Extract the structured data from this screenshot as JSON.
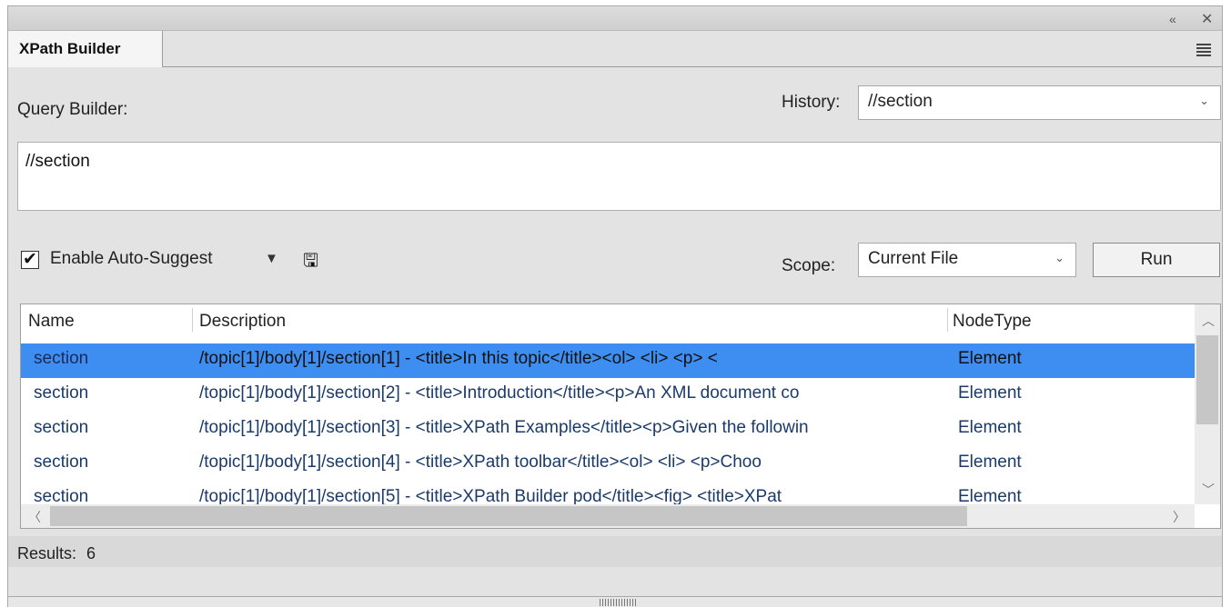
{
  "window": {
    "collapse_glyph": "«",
    "close_glyph": "✕"
  },
  "tab": {
    "label": "XPath Builder"
  },
  "query_builder": {
    "label": "Query Builder:",
    "value": "//section"
  },
  "history": {
    "label": "History:",
    "selected": "//section"
  },
  "autosuggest": {
    "label": "Enable Auto-Suggest",
    "checked": true,
    "check_glyph": "✔",
    "dropdown_glyph": "▼",
    "save_glyph": "🖫"
  },
  "scope": {
    "label": "Scope:",
    "selected": "Current File"
  },
  "run_button": {
    "label": "Run"
  },
  "results_table": {
    "columns": [
      "Name",
      "Description",
      "NodeType"
    ],
    "rows": [
      {
        "name": "section",
        "description": "/topic[1]/body[1]/section[1] - <title>In this topic</title><ol>    <li>     <p>       <",
        "type": "Element",
        "selected": true
      },
      {
        "name": "section",
        "description": "/topic[1]/body[1]/section[2] - <title>Introduction</title><p>An XML document co",
        "type": "Element",
        "selected": false
      },
      {
        "name": "section",
        "description": "/topic[1]/body[1]/section[3] - <title>XPath Examples</title><p>Given the followin",
        "type": "Element",
        "selected": false
      },
      {
        "name": "section",
        "description": "/topic[1]/body[1]/section[4] - <title>XPath toolbar</title><ol>    <li>     <p>Choo",
        "type": "Element",
        "selected": false
      },
      {
        "name": "section",
        "description": "/topic[1]/body[1]/section[5] - <title>XPath Builder pod</title><fig>     <title>XPat",
        "type": "Element",
        "selected": false
      }
    ]
  },
  "status": {
    "results_label": "Results:",
    "results_count": "6"
  },
  "colors": {
    "selection": "#3d8ef0",
    "panel_bg": "#e3e3e3"
  }
}
